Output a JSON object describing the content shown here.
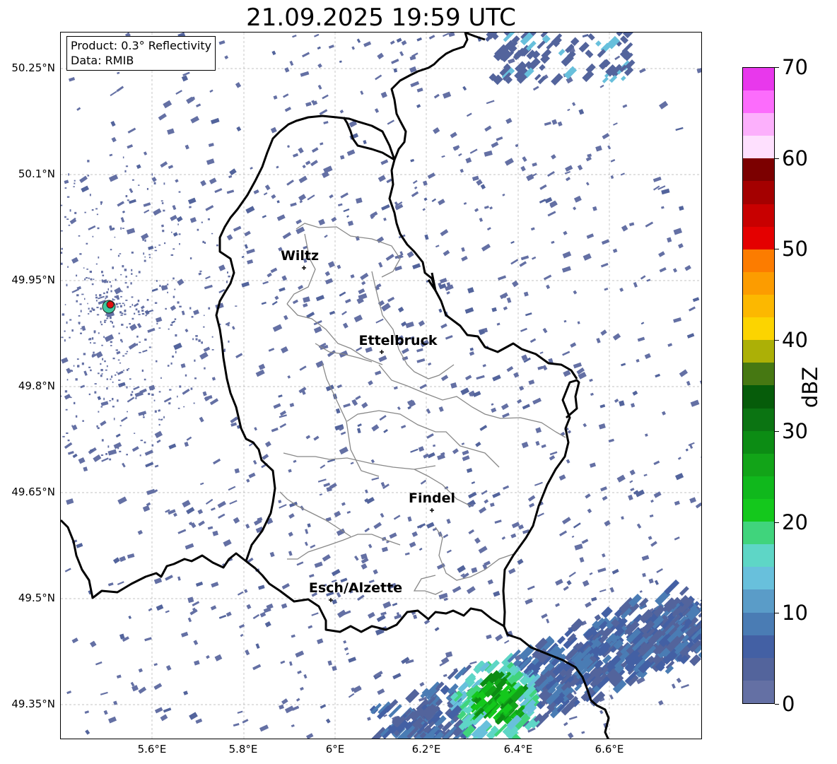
{
  "title": "21.09.2025 19:59 UTC",
  "info": {
    "product": "Product: 0.3° Reflectivity",
    "data": "Data: RMIB"
  },
  "lat_labels": [
    "50.25°N",
    "50.1°N",
    "49.95°N",
    "49.8°N",
    "49.65°N",
    "49.5°N",
    "49.35°N"
  ],
  "lon_labels": [
    "5.6°E",
    "5.8°E",
    "6°E",
    "6.2°E",
    "6.4°E",
    "6.6°E"
  ],
  "cities": [
    {
      "name": "Wiltz"
    },
    {
      "name": "Ettelbruck"
    },
    {
      "name": "Findel"
    },
    {
      "name": "Esch/Alzette"
    }
  ],
  "colorbar": {
    "label": "dBZ",
    "min": 0,
    "max": 70,
    "ticks": [
      "0",
      "10",
      "20",
      "30",
      "40",
      "50",
      "60",
      "70"
    ],
    "colors": [
      "#6470a4",
      "#53649c",
      "#4360a4",
      "#4a7cb4",
      "#5a9cc8",
      "#68c0dc",
      "#5ed6c6",
      "#40d47c",
      "#14c81c",
      "#10b81c",
      "#12a418",
      "#0c8c14",
      "#0b7412",
      "#065c0a",
      "#467812",
      "#acb006",
      "#fcd400",
      "#fcb800",
      "#fc9c00",
      "#fc7c00",
      "#e40000",
      "#c80000",
      "#a40000",
      "#7c0000",
      "#fee0fe",
      "#fcb0fc",
      "#fc6cfc",
      "#e838ec"
    ]
  }
}
